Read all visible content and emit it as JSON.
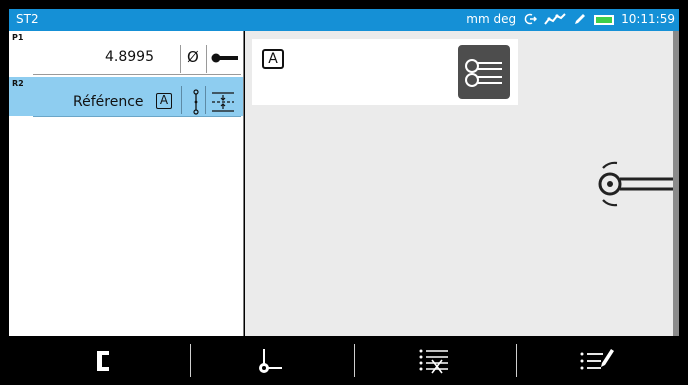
{
  "statusbar": {
    "title": "ST2",
    "units": "mm deg",
    "time": "10:11:59",
    "icons": [
      "rotate-arrow-icon",
      "calibration-wave-icon",
      "probe-pencil-icon",
      "battery-icon"
    ],
    "background": "#1590d6",
    "battery_color": "#3fcf4a"
  },
  "results": [
    {
      "id": "P1",
      "value": "4.8995",
      "icons": [
        "diameter-icon",
        "probe-icon"
      ]
    },
    {
      "id": "R2",
      "label": "Référence",
      "badge": "A",
      "selected": true,
      "icons": [
        "vertical-axis-icon",
        "center-line-icon"
      ]
    }
  ],
  "detail": {
    "badge": "A",
    "probe_button_icon": "double-probe-icon",
    "diagram_icon": "probe-with-tolerance-icon"
  },
  "toolbar": {
    "buttons": [
      {
        "name": "bracket-icon"
      },
      {
        "name": "point-on-plane-icon"
      },
      {
        "name": "delete-list-icon"
      },
      {
        "name": "edit-list-icon"
      }
    ]
  },
  "colors": {
    "selected_row": "#8ecdf0",
    "right_panel": "#ebebeb",
    "probe_button": "#4d4d4d"
  }
}
